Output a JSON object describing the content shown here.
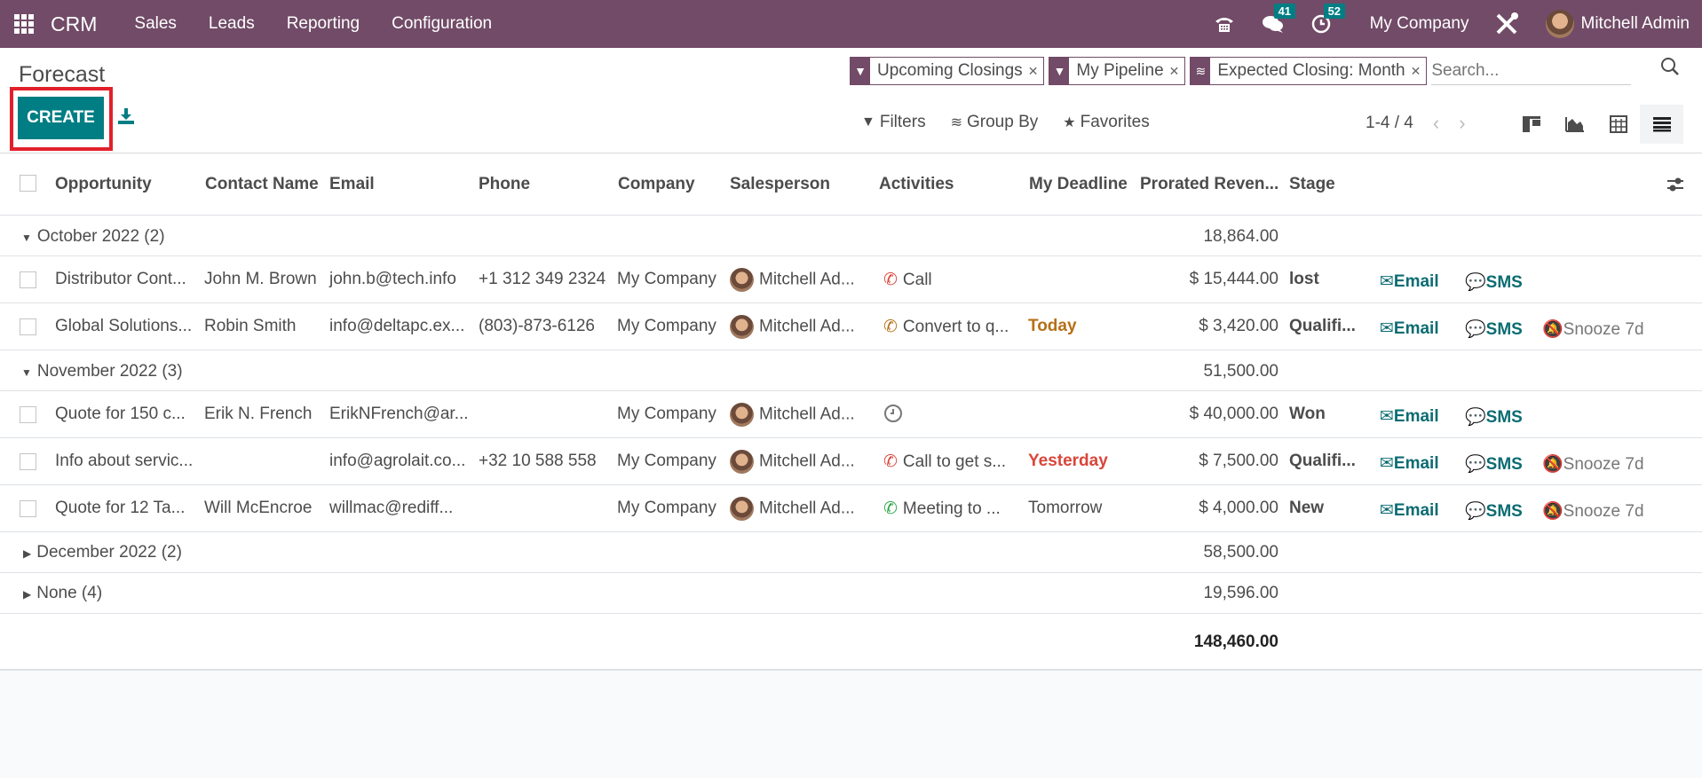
{
  "navbar": {
    "brand": "CRM",
    "menu": [
      "Sales",
      "Leads",
      "Reporting",
      "Configuration"
    ],
    "messages_count": "41",
    "activities_count": "52",
    "company": "My Company",
    "user": "Mitchell Admin"
  },
  "control": {
    "title": "Forecast",
    "create_label": "CREATE",
    "facets": [
      {
        "type": "filter",
        "label": "Upcoming Closings"
      },
      {
        "type": "filter",
        "label": "My Pipeline"
      },
      {
        "type": "groupby",
        "label": "Expected Closing: Month"
      }
    ],
    "search_placeholder": "Search...",
    "filters_label": "Filters",
    "groupby_label": "Group By",
    "favorites_label": "Favorites",
    "pager": "1-4 / 4",
    "views": [
      "kanban",
      "graph",
      "pivot",
      "list"
    ],
    "active_view": "list"
  },
  "table": {
    "headers": [
      "Opportunity",
      "Contact Name",
      "Email",
      "Phone",
      "Company",
      "Salesperson",
      "Activities",
      "My Deadline",
      "Prorated Reven...",
      "Stage"
    ],
    "groups": [
      {
        "label": "October 2022 (2)",
        "expanded": true,
        "total": "18,864.00",
        "rows": [
          {
            "opportunity": "Distributor Cont...",
            "contact": "John M. Brown",
            "email": "john.b@tech.info",
            "phone": "+1 312 349 2324",
            "company": "My Company",
            "salesperson": "Mitchell Ad...",
            "activity": "Call",
            "activity_icon": "phone-icon",
            "activity_color": "#d9463a",
            "deadline": "",
            "deadline_color": "",
            "revenue": "$ 15,444.00",
            "stage": "lost",
            "email_btn": "Email",
            "sms_btn": "SMS",
            "snooze": ""
          },
          {
            "opportunity": "Global Solutions...",
            "contact": "Robin Smith",
            "email": "info@deltapc.ex...",
            "phone": "(803)-873-6126",
            "company": "My Company",
            "salesperson": "Mitchell Ad...",
            "activity": "Convert to q...",
            "activity_icon": "phone-icon",
            "activity_color": "#b57018",
            "deadline": "Today",
            "deadline_color": "#b57018",
            "revenue": "$ 3,420.00",
            "stage": "Qualifi...",
            "email_btn": "Email",
            "sms_btn": "SMS",
            "snooze": "Snooze 7d"
          }
        ]
      },
      {
        "label": "November 2022 (3)",
        "expanded": true,
        "total": "51,500.00",
        "rows": [
          {
            "opportunity": "Quote for 150 c...",
            "contact": "Erik N. French",
            "email": "ErikNFrench@ar...",
            "phone": "",
            "company": "My Company",
            "salesperson": "Mitchell Ad...",
            "activity": "",
            "activity_icon": "clock-icon",
            "activity_color": "#777777",
            "deadline": "",
            "deadline_color": "",
            "revenue": "$ 40,000.00",
            "stage": "Won",
            "email_btn": "Email",
            "sms_btn": "SMS",
            "snooze": ""
          },
          {
            "opportunity": "Info about servic...",
            "contact": "",
            "email": "info@agrolait.co...",
            "phone": "+32 10 588 558",
            "company": "My Company",
            "salesperson": "Mitchell Ad...",
            "activity": "Call to get s...",
            "activity_icon": "phone-icon",
            "activity_color": "#d9463a",
            "deadline": "Yesterday",
            "deadline_color": "#d9463a",
            "revenue": "$ 7,500.00",
            "stage": "Qualifi...",
            "email_btn": "Email",
            "sms_btn": "SMS",
            "snooze": "Snooze 7d"
          },
          {
            "opportunity": "Quote for 12 Ta...",
            "contact": "Will McEncroe",
            "email": "willmac@rediff...",
            "phone": "",
            "company": "My Company",
            "salesperson": "Mitchell Ad...",
            "activity": "Meeting to ...",
            "activity_icon": "phone-icon",
            "activity_color": "#28a745",
            "deadline": "Tomorrow",
            "deadline_color": "#4c4c4c",
            "revenue": "$ 4,000.00",
            "stage": "New",
            "email_btn": "Email",
            "sms_btn": "SMS",
            "snooze": "Snooze 7d"
          }
        ]
      },
      {
        "label": "December 2022 (2)",
        "expanded": false,
        "total": "58,500.00",
        "rows": []
      },
      {
        "label": "None (4)",
        "expanded": false,
        "total": "19,596.00",
        "rows": []
      }
    ],
    "grand_total": "148,460.00"
  },
  "colors": {
    "brand": "#714b67",
    "accent": "#017e84",
    "action": "#0b6c72"
  }
}
